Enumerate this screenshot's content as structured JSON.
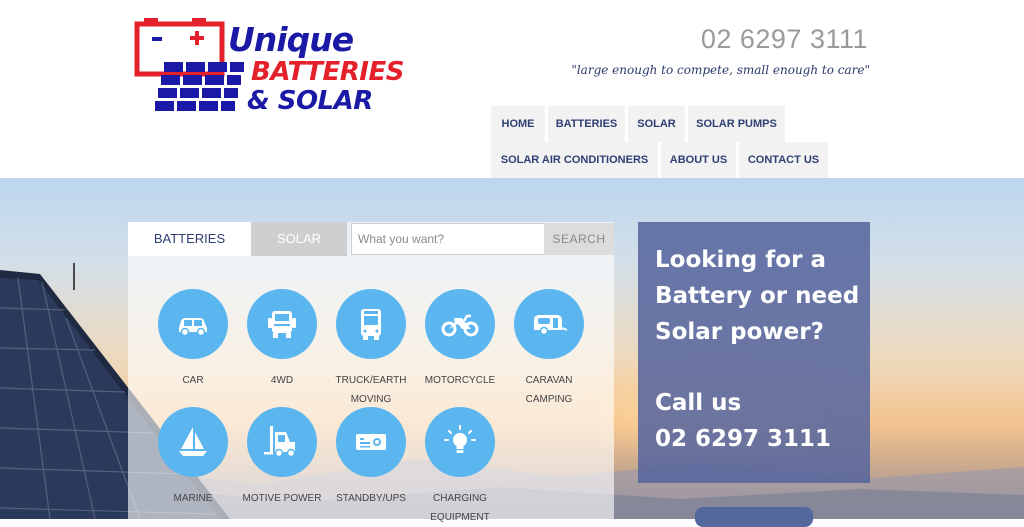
{
  "header": {
    "logo": {
      "line1": "Unique",
      "line2": "BATTERIES",
      "line3": "& SOLAR",
      "colors": {
        "blue": "#1a1aa6",
        "red": "#e4202a"
      }
    },
    "phone": "02 6297 3111",
    "tagline": "\"large enough to compete, small enough to care\""
  },
  "nav": {
    "items": [
      {
        "label": "HOME"
      },
      {
        "label": "BATTERIES"
      },
      {
        "label": "SOLAR"
      },
      {
        "label": "SOLAR PUMPS"
      },
      {
        "label": "SOLAR AIR CONDITIONERS"
      },
      {
        "label": "ABOUT US"
      },
      {
        "label": "CONTACT US"
      }
    ]
  },
  "search": {
    "tabs": [
      {
        "label": "BATTERIES",
        "active": true
      },
      {
        "label": "SOLAR",
        "active": false
      }
    ],
    "placeholder": "What you want?",
    "button": "SEARCH",
    "categories": [
      {
        "label1": "CAR",
        "label2": "",
        "icon": "car-icon"
      },
      {
        "label1": "4WD",
        "label2": "",
        "icon": "4wd-icon"
      },
      {
        "label1": "TRUCK/EARTH",
        "label2": "MOVING",
        "icon": "truck-icon"
      },
      {
        "label1": "MOTORCYCLE",
        "label2": "",
        "icon": "motorcycle-icon"
      },
      {
        "label1": "CARAVAN",
        "label2": "CAMPING",
        "icon": "caravan-icon"
      },
      {
        "label1": "MARINE",
        "label2": "",
        "icon": "sailboat-icon"
      },
      {
        "label1": "MOTIVE POWER",
        "label2": "",
        "icon": "forklift-icon"
      },
      {
        "label1": "STANDBY/UPS",
        "label2": "",
        "icon": "ups-icon"
      },
      {
        "label1": "CHARGING",
        "label2": "EQUIPMENT",
        "icon": "charging-bulb-icon"
      }
    ],
    "accent_color": "#5bb6ef"
  },
  "cta": {
    "line1": "Looking for a",
    "line2": "Battery or need",
    "line3": "Solar power?",
    "call": "Call us",
    "phone": "02 6297 3111",
    "background": "#58679e"
  }
}
